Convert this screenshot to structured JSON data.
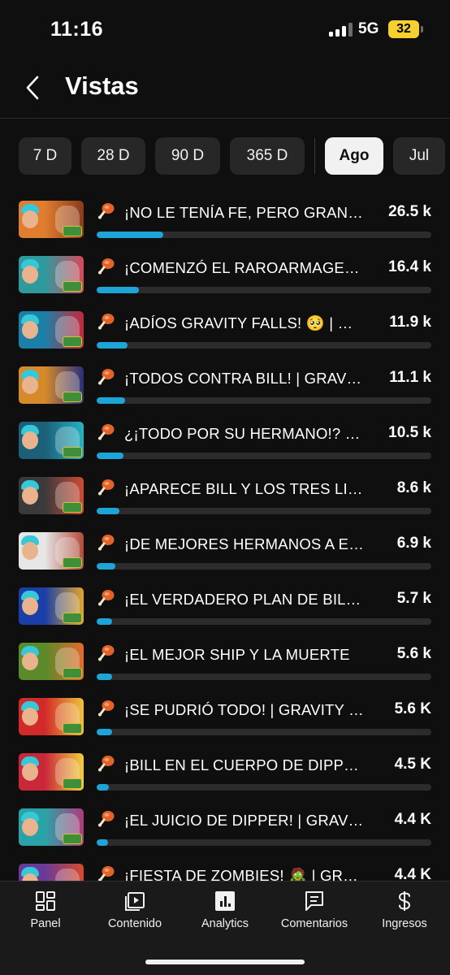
{
  "status_bar": {
    "time": "11:16",
    "network": "5G",
    "battery": "32"
  },
  "header": {
    "title": "Vistas"
  },
  "periods": [
    {
      "label": "7 D",
      "active": false
    },
    {
      "label": "28 D",
      "active": false
    },
    {
      "label": "90 D",
      "active": false
    },
    {
      "label": "365 D",
      "active": false
    },
    {
      "label": "Ago",
      "active": true
    },
    {
      "label": "Jul",
      "active": false
    }
  ],
  "videos": [
    {
      "title": "¡NO LE TENÍA FE, PERO GRANDE",
      "views": "26.5 k",
      "fraction": 0.2,
      "thumb_bg": [
        "#e07d2e",
        "#8a3b1a"
      ]
    },
    {
      "title": "¡COMENZÓ EL RAROARMAGEDÓN",
      "views": "16.4 k",
      "fraction": 0.126,
      "thumb_bg": [
        "#2f9a9e",
        "#d64a5a"
      ]
    },
    {
      "title": "¡ADÍOS GRAVITY FALLS! 🥺 | GRAVITY FALLS",
      "views": "11.9 k",
      "fraction": 0.092,
      "thumb_bg": [
        "#1c7fa8",
        "#c6283a"
      ]
    },
    {
      "title": "¡TODOS CONTRA BILL! | GRAVITY FALLS",
      "views": "11.1 k",
      "fraction": 0.086,
      "thumb_bg": [
        "#d68a2a",
        "#2a2f7a"
      ]
    },
    {
      "title": "¿¡TODO POR SU HERMANO!? | GRAVITY FALLS",
      "views": "10.5 k",
      "fraction": 0.081,
      "thumb_bg": [
        "#1b5f78",
        "#26b3c4"
      ]
    },
    {
      "title": "¡APARECE BILL Y LOS TRES LIBROS",
      "views": "8.6 k",
      "fraction": 0.068,
      "thumb_bg": [
        "#3a3a3a",
        "#cf4a35"
      ]
    },
    {
      "title": "¡DE MEJORES HERMANOS A ENEMIGOS",
      "views": "6.9 k",
      "fraction": 0.055,
      "thumb_bg": [
        "#e6e6e6",
        "#b14a3a"
      ]
    },
    {
      "title": "¡EL VERDADERO PLAN DE BILL CIPHER",
      "views": "5.7 k",
      "fraction": 0.046,
      "thumb_bg": [
        "#1a3fa8",
        "#e2a52a"
      ]
    },
    {
      "title": "¡EL MEJOR SHIP Y LA MUERTE",
      "views": "5.6 k",
      "fraction": 0.045,
      "thumb_bg": [
        "#5a8a2a",
        "#e56a2a"
      ]
    },
    {
      "title": "¡SE PUDRIÓ TODO! | GRAVITY FALLS",
      "views": "5.6 K",
      "fraction": 0.045,
      "thumb_bg": [
        "#d22a2a",
        "#f0c23a"
      ]
    },
    {
      "title": "¡BILL EN EL CUERPO DE DIPPER",
      "views": "4.5 K",
      "fraction": 0.036,
      "thumb_bg": [
        "#c8283a",
        "#f2d03a"
      ]
    },
    {
      "title": "¡EL JUICIO DE DIPPER! | GRAVITY FALLS",
      "views": "4.4 K",
      "fraction": 0.035,
      "thumb_bg": [
        "#2aa3a8",
        "#b03a7a"
      ]
    },
    {
      "title": "¡FIESTA DE ZOMBIES! 🧟 | GRAVITY FALLS",
      "views": "4.4 K",
      "fraction": 0.035,
      "thumb_bg": [
        "#6a3a9a",
        "#d84a2a"
      ]
    }
  ],
  "bottom_nav": [
    {
      "label": "Panel",
      "icon": "dashboard-icon"
    },
    {
      "label": "Contenido",
      "icon": "content-icon"
    },
    {
      "label": "Analytics",
      "icon": "analytics-icon"
    },
    {
      "label": "Comentarios",
      "icon": "comments-icon"
    },
    {
      "label": "Ingresos",
      "icon": "dollar-icon"
    }
  ],
  "colors": {
    "accent_bar": "#1ea5d8",
    "battery": "#f5d02f",
    "background": "#0f0f0f"
  }
}
